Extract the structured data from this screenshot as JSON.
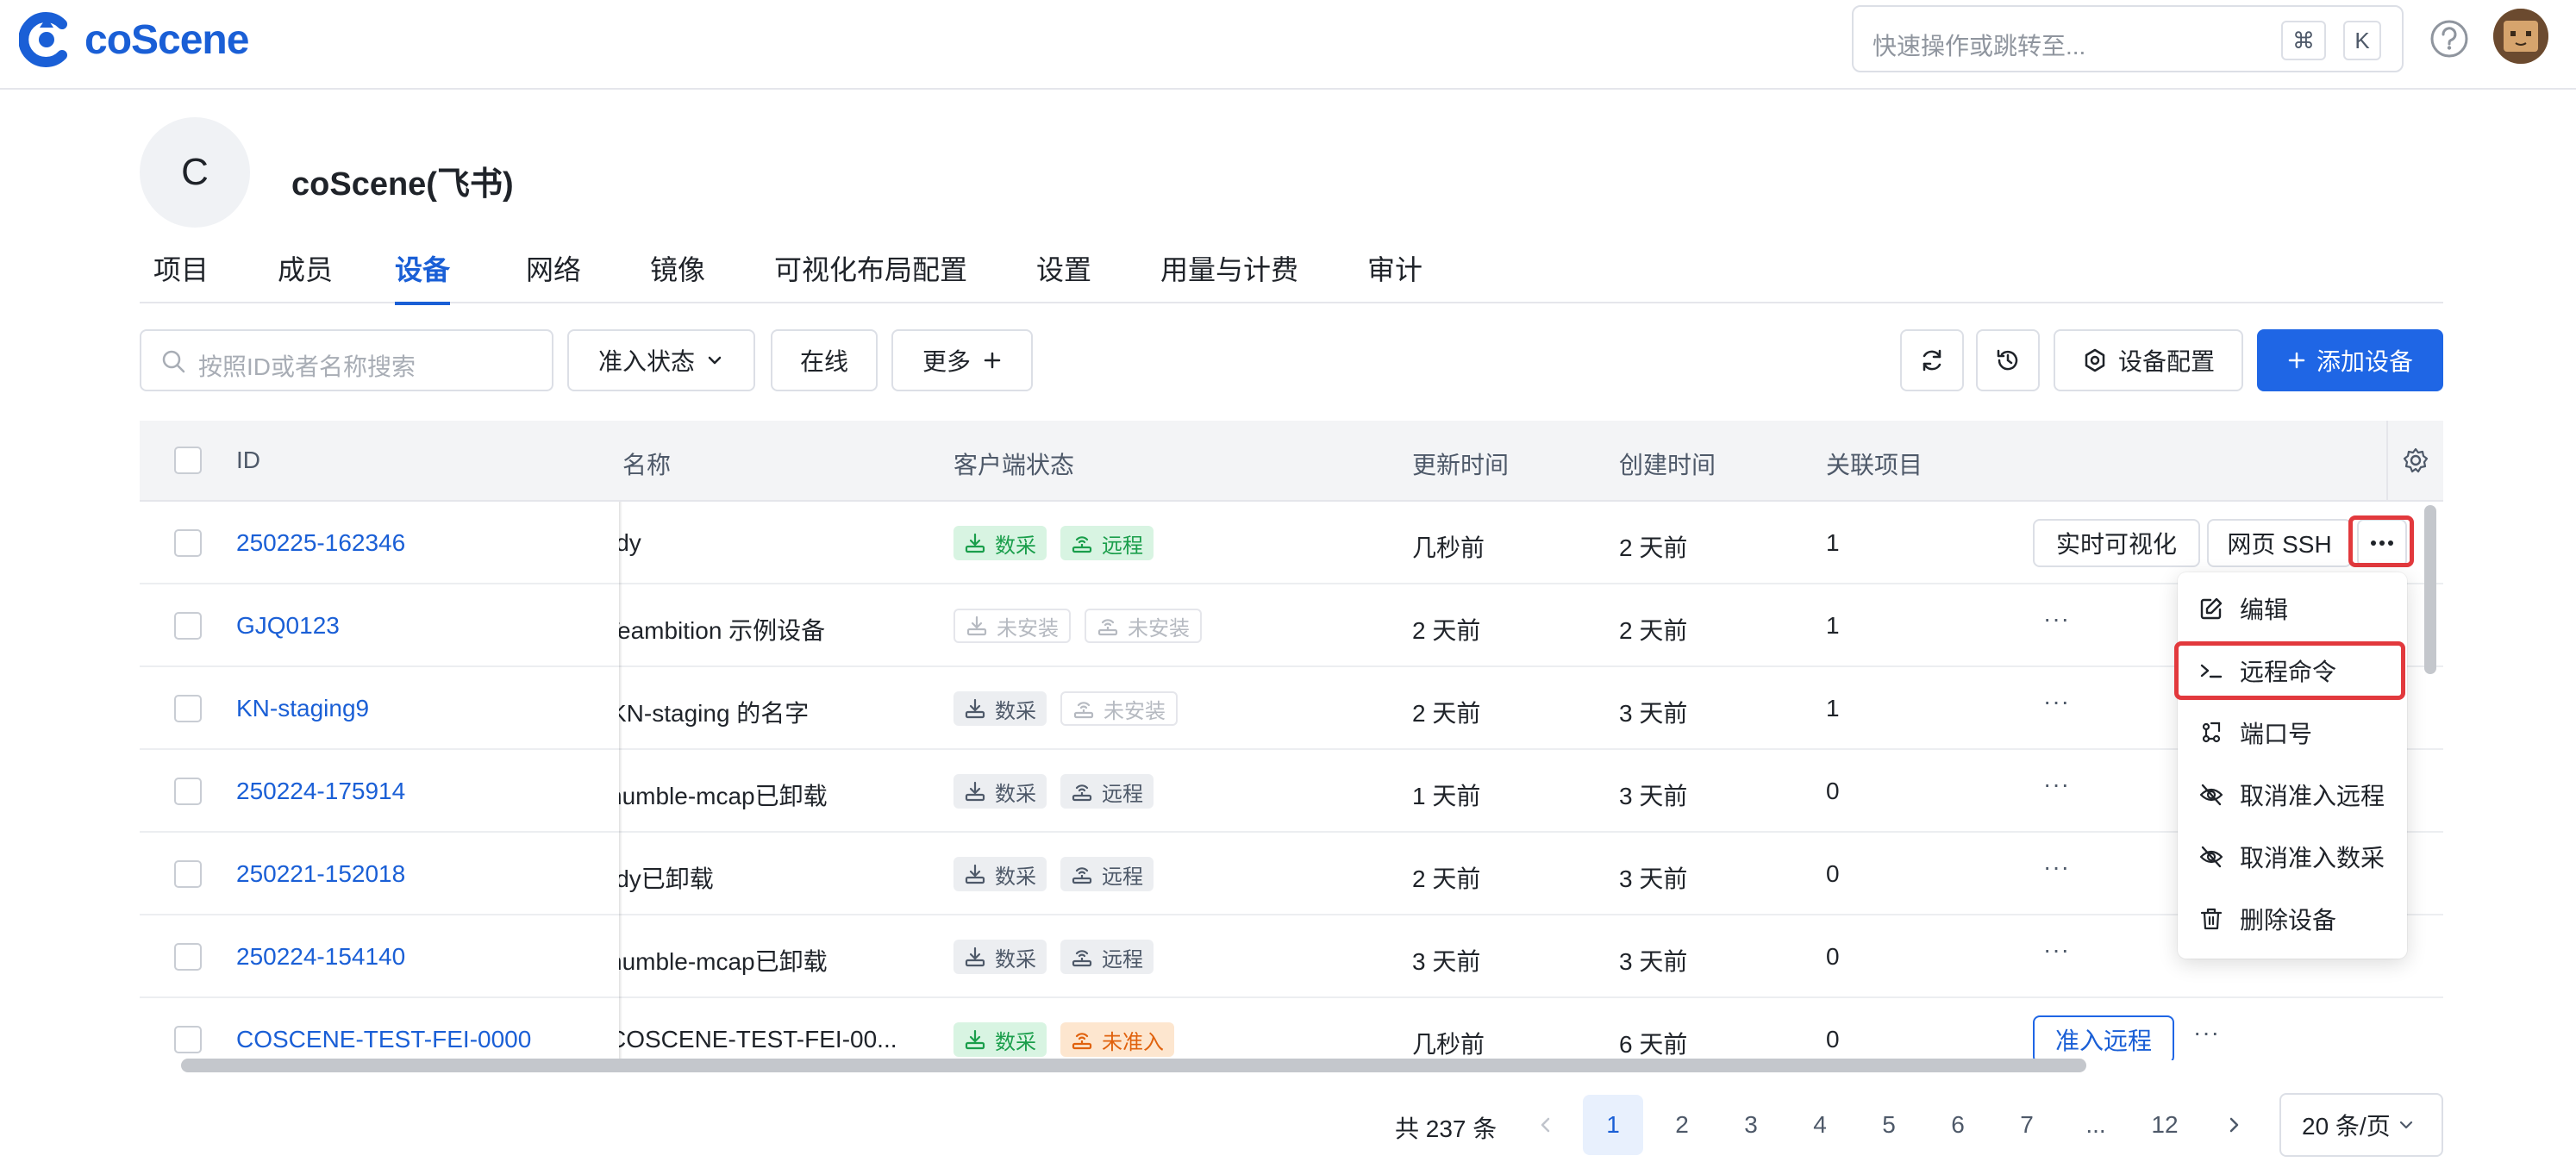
{
  "app": {
    "logo_text": "coScene"
  },
  "search": {
    "placeholder": "快速操作或跳转至...",
    "kbd1": "⌘",
    "kbd2": "K"
  },
  "org": {
    "initial": "C",
    "name": "coScene(飞书)"
  },
  "tabs": [
    {
      "label": "项目"
    },
    {
      "label": "成员"
    },
    {
      "label": "设备"
    },
    {
      "label": "网络"
    },
    {
      "label": "镜像"
    },
    {
      "label": "可视化布局配置"
    },
    {
      "label": "设置"
    },
    {
      "label": "用量与计费"
    },
    {
      "label": "审计"
    }
  ],
  "active_tab": "设备",
  "toolbar": {
    "search_placeholder": "按照ID或者名称搜索",
    "filter_status": "准入状态",
    "filter_online": "在线",
    "filter_more": "更多",
    "device_config": "设备配置",
    "add_device": "添加设备"
  },
  "table": {
    "headers": {
      "id": "ID",
      "name": "名称",
      "client_status": "客户端状态",
      "updated": "更新时间",
      "created": "创建时间",
      "projects": "关联项目"
    },
    "rows": [
      {
        "id": "250225-162346",
        "name": "ldy",
        "tag1": "数采",
        "tag2": "远程",
        "updated": "几秒前",
        "created": "2 天前",
        "projects": "1",
        "action1": "实时可视化",
        "action2": "网页 SSH"
      },
      {
        "id": "GJQ0123",
        "name": "Teambition 示例设备",
        "tag1": "未安装",
        "tag2": "未安装",
        "updated": "2 天前",
        "created": "2 天前",
        "projects": "1"
      },
      {
        "id": "KN-staging9",
        "name": "KN-staging 的名字",
        "tag1": "数采",
        "tag2": "未安装",
        "updated": "2 天前",
        "created": "3 天前",
        "projects": "1"
      },
      {
        "id": "250224-175914",
        "name": "humble-mcap已卸载",
        "tag1": "数采",
        "tag2": "远程",
        "updated": "1 天前",
        "created": "3 天前",
        "projects": "0"
      },
      {
        "id": "250221-152018",
        "name": "ldy已卸载",
        "tag1": "数采",
        "tag2": "远程",
        "updated": "2 天前",
        "created": "3 天前",
        "projects": "0"
      },
      {
        "id": "250224-154140",
        "name": "humble-mcap已卸载",
        "tag1": "数采",
        "tag2": "远程",
        "updated": "3 天前",
        "created": "3 天前",
        "projects": "0"
      },
      {
        "id": "COSCENE-TEST-FEI-0000",
        "name": "COSCENE-TEST-FEI-00...",
        "tag1": "数采",
        "tag2": "未准入",
        "updated": "几秒前",
        "created": "6 天前",
        "projects": "0",
        "action1": "准入远程"
      }
    ]
  },
  "menu": {
    "items": [
      {
        "label": "编辑",
        "icon": "edit-icon"
      },
      {
        "label": "远程命令",
        "icon": "terminal-icon"
      },
      {
        "label": "端口号",
        "icon": "port-icon"
      },
      {
        "label": "取消准入远程",
        "icon": "eye-off-icon"
      },
      {
        "label": "取消准入数采",
        "icon": "eye-off-icon"
      },
      {
        "label": "删除设备",
        "icon": "trash-icon"
      }
    ]
  },
  "pagination": {
    "total": "共 237 条",
    "pages": [
      "1",
      "2",
      "3",
      "4",
      "5",
      "6",
      "7",
      "...",
      "12"
    ],
    "current": "1",
    "page_size": "20 条/页"
  },
  "colors": {
    "brand": "#1a5fd6",
    "primary_button": "#1f66e5",
    "highlight": "#e2393d"
  }
}
